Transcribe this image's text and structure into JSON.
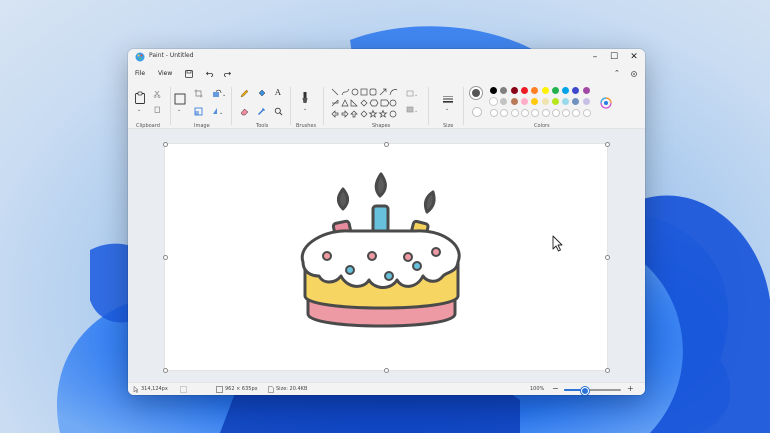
{
  "window": {
    "title": "Paint - Untitled"
  },
  "menu": {
    "file": "File",
    "view": "View"
  },
  "ribbon_groups": {
    "clipboard": "Clipboard",
    "image": "Image",
    "tools": "Tools",
    "brushes": "Brushes",
    "shapes": "Shapes",
    "size": "Size",
    "colors": "Colors"
  },
  "status": {
    "cursor_position": "314,124px",
    "canvas_size": "962 × 635px",
    "file_size": "Size: 20.4KB",
    "zoom": "100%"
  },
  "icons": {
    "undo": "undo-icon",
    "redo": "redo-icon",
    "save": "save-icon",
    "paste": "paste-icon"
  },
  "colors": {
    "selected_primary": "#555555",
    "palette_row1": [
      "#000000",
      "#7f7f7f",
      "#880015",
      "#ed1c24",
      "#ff7f27",
      "#fff200",
      "#22b14c",
      "#00a2e8",
      "#3f48cc",
      "#a349a4"
    ],
    "palette_row2": [
      "#ffffff",
      "#c3c3c3",
      "#b97a57",
      "#ffaec9",
      "#ffc90e",
      "#efe4b0",
      "#b5e61d",
      "#99d9ea",
      "#7092be",
      "#c8bfe7"
    ]
  }
}
